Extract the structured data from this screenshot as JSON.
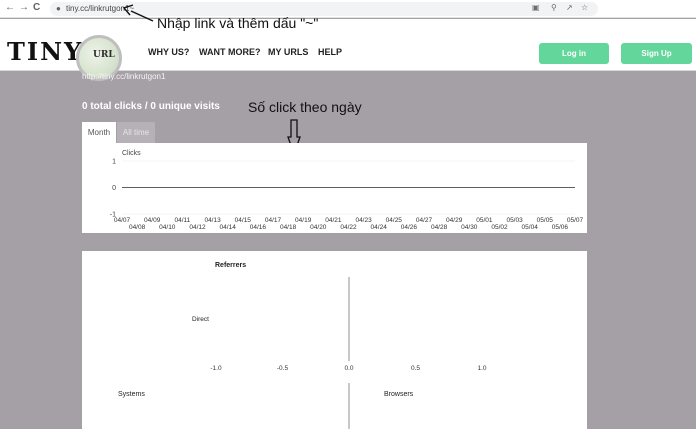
{
  "browser": {
    "back_glyph": "←",
    "forward_glyph": "→",
    "reload_glyph": "C",
    "lock_glyph": "🔒",
    "url": "tiny.cc/linkrutgon1~",
    "icons": [
      "translate-icon",
      "zoom-icon",
      "share-icon",
      "star-icon"
    ]
  },
  "annotations": {
    "url_note": "Nhập link và thêm dấu \"~\"",
    "chart_note": "Số click theo ngày"
  },
  "header": {
    "logo_text": "TINY",
    "logo_lens_text": "URL",
    "nav": [
      "WHY US?",
      "WANT MORE?",
      "MY URLS",
      "HELP"
    ],
    "login_label": "Log in",
    "signup_label": "Sign Up",
    "accent_color": "#63d79b"
  },
  "content": {
    "short_url": "http://tiny.cc/linkrutgon1",
    "stats": {
      "total_clicks": "0",
      "total_clicks_label": "total clicks",
      "separator": "/",
      "unique_visits": "0",
      "unique_visits_label": "unique visits"
    },
    "tabs": [
      {
        "label": "Month",
        "active": true
      },
      {
        "label": "All time",
        "active": false
      }
    ]
  },
  "chart_data": [
    {
      "type": "line",
      "title": "",
      "ylabel": "Clicks",
      "ylim": [
        -1,
        1
      ],
      "yticks": [
        "1",
        "0",
        "-1"
      ],
      "x_top": [
        "04/07",
        "04/09",
        "04/11",
        "04/13",
        "04/15",
        "04/17",
        "04/19",
        "04/21",
        "04/23",
        "04/25",
        "04/27",
        "04/29",
        "05/01",
        "05/03",
        "05/05",
        "05/07"
      ],
      "x_bottom": [
        "04/08",
        "04/10",
        "04/12",
        "04/14",
        "04/16",
        "04/18",
        "04/20",
        "04/22",
        "04/24",
        "04/26",
        "04/28",
        "04/30",
        "05/02",
        "05/04",
        "05/06"
      ],
      "values": [
        0,
        0,
        0,
        0,
        0,
        0,
        0,
        0,
        0,
        0,
        0,
        0,
        0,
        0,
        0,
        0,
        0,
        0,
        0,
        0,
        0,
        0,
        0,
        0,
        0,
        0,
        0,
        0,
        0,
        0,
        0
      ]
    },
    {
      "type": "bar",
      "title": "Referrers",
      "categories": [
        "Direct"
      ],
      "values": [
        0
      ],
      "xlim": [
        -1.0,
        1.0
      ],
      "xticks": [
        "-1.0",
        "-0.5",
        "0.0",
        "0.5",
        "1.0"
      ]
    }
  ],
  "sub_charts": {
    "systems_title": "Systems",
    "browsers_title": "Browsers"
  }
}
